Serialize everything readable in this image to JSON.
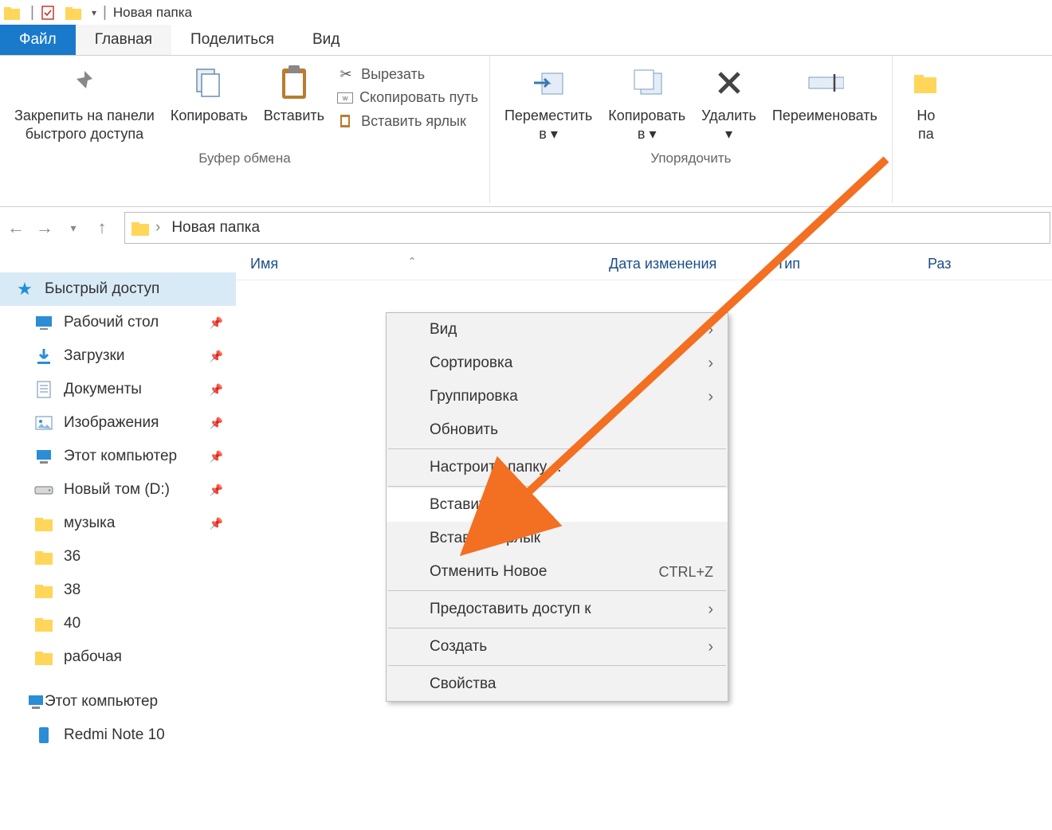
{
  "titlebar": {
    "title": "Новая папка"
  },
  "tabs": {
    "file": "Файл",
    "home": "Главная",
    "share": "Поделиться",
    "view": "Вид"
  },
  "ribbon": {
    "group_clipboard": "Буфер обмена",
    "group_organize": "Упорядочить",
    "pin": "Закрепить на панели\nбыстрого доступа",
    "copy": "Копировать",
    "paste": "Вставить",
    "cut": "Вырезать",
    "copy_path": "Скопировать путь",
    "paste_shortcut": "Вставить ярлык",
    "move_to": "Переместить\nв ▾",
    "copy_to": "Копировать\nв ▾",
    "delete": "Удалить\n▾",
    "rename": "Переименовать",
    "new_partial": "Но\nпа"
  },
  "address": {
    "crumb": "Новая папка"
  },
  "columns": {
    "name": "Имя",
    "date": "Дата изменения",
    "type": "Тип",
    "size": "Раз"
  },
  "sidebar": {
    "quick": "Быстрый доступ",
    "items": [
      {
        "label": "Рабочий стол",
        "icon": "desktop",
        "pin": true
      },
      {
        "label": "Загрузки",
        "icon": "downloads",
        "pin": true
      },
      {
        "label": "Документы",
        "icon": "documents",
        "pin": true
      },
      {
        "label": "Изображения",
        "icon": "pictures",
        "pin": true
      },
      {
        "label": "Этот компьютер",
        "icon": "pc",
        "pin": true
      },
      {
        "label": "Новый том (D:)",
        "icon": "drive",
        "pin": true
      },
      {
        "label": "музыка",
        "icon": "folder",
        "pin": true
      },
      {
        "label": "36",
        "icon": "folder",
        "pin": false
      },
      {
        "label": "38",
        "icon": "folder",
        "pin": false
      },
      {
        "label": "40",
        "icon": "folder",
        "pin": false
      },
      {
        "label": "рабочая",
        "icon": "folder",
        "pin": false
      }
    ],
    "this_pc": "Этот компьютер",
    "phone": "Redmi Note 10"
  },
  "context_menu": {
    "view": "Вид",
    "sort": "Сортировка",
    "group": "Группировка",
    "refresh": "Обновить",
    "customize": "Настроить папку…",
    "paste": "Вставить",
    "paste_shortcut": "Вставить ярлык",
    "undo": "Отменить Новое",
    "undo_shortcut": "CTRL+Z",
    "share": "Предоставить доступ к",
    "new": "Создать",
    "properties": "Свойства"
  }
}
